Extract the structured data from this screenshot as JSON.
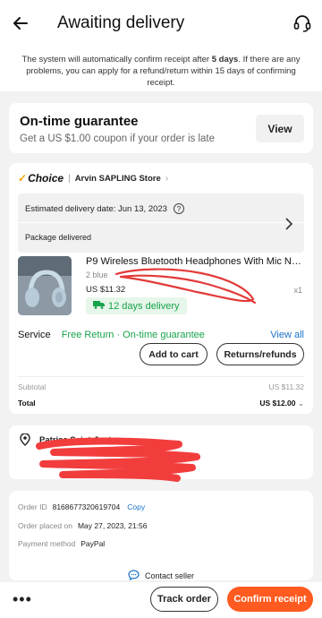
{
  "header": {
    "title": "Awaiting delivery"
  },
  "notice": {
    "part1": "The system will automatically confirm receipt after ",
    "bold": "5 days",
    "part2": ". If there are any problems, you can apply for a refund/return within 15 days of confirming receipt."
  },
  "guarantee": {
    "title": "On-time guarantee",
    "subtitle": "Get a US $1.00 coupon if your order is late",
    "view_label": "View"
  },
  "store": {
    "badge": "Choice",
    "name": "Arvin SAPLING Store"
  },
  "delivery": {
    "estimated": "Estimated delivery date: Jun 13, 2023",
    "status": "Package delivered"
  },
  "product": {
    "name": "P9 Wireless Bluetooth Headphones With Mic Noise C...",
    "variant": "2 blue",
    "price": "US $11.32",
    "qty": "x1",
    "days": "12 days delivery"
  },
  "service": {
    "label": "Service",
    "value": "Free Return · On-time guarantee",
    "view_all": "View all"
  },
  "actions": {
    "add_to_cart": "Add to cart",
    "returns": "Returns/refunds"
  },
  "summary": {
    "subtotal_label": "Subtotal",
    "subtotal_value": "US $11.32",
    "total_label": "Total",
    "total_value": "US $12.00"
  },
  "address": {
    "name": "Patrice Saint-Juste"
  },
  "info": {
    "order_id_label": "Order ID",
    "order_id": "8168677320619704",
    "copy": "Copy",
    "placed_label": "Order placed on",
    "placed": "May 27, 2023, 21:56",
    "payment_label": "Payment method",
    "payment": "PayPal",
    "contact": "Contact seller"
  },
  "bottom": {
    "more": "•••",
    "track": "Track order",
    "confirm": "Confirm receipt"
  },
  "colors": {
    "accent": "#ff5a1f",
    "green": "#17a34a",
    "link": "#1a73c9",
    "redaction": "#f23d3d"
  }
}
